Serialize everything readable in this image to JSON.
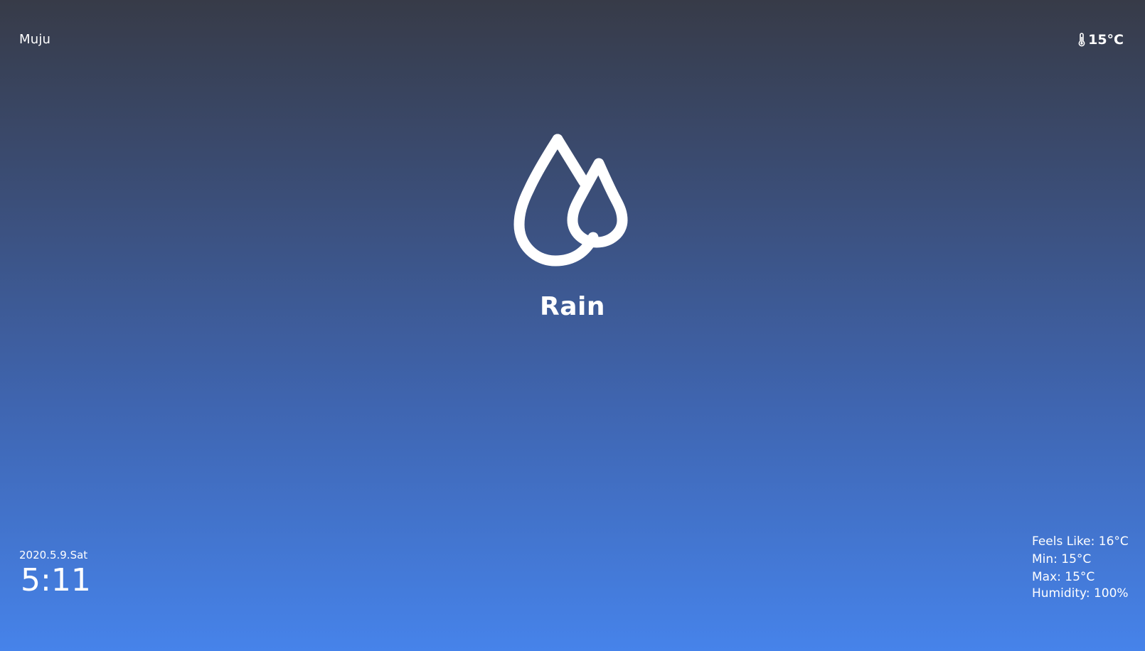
{
  "header": {
    "location": "Muju",
    "temperature": "15°C",
    "temperature_icon": "thermometer-icon"
  },
  "current": {
    "condition": "Rain",
    "condition_icon": "raindrops-icon"
  },
  "datetime": {
    "date": "2020.5.9.Sat",
    "time": "5:11"
  },
  "details": {
    "feels_like": "Feels Like: 16°C",
    "min": "Min: 15°C",
    "max": "Max: 15°C",
    "humidity": "Humidity: 100%"
  },
  "colors": {
    "gradient_top": "#373b48",
    "gradient_bottom": "#4683ea",
    "text": "#ffffff"
  }
}
